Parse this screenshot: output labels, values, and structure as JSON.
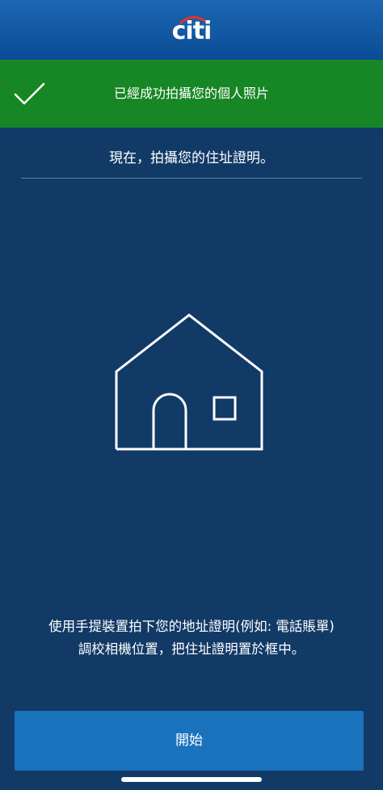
{
  "header": {
    "logo_text": "citi",
    "logo_icon": "citi-arc-logo",
    "background_color": "#0a4c95"
  },
  "success_banner": {
    "icon": "checkmark-icon",
    "message": "已經成功拍攝您的個人照片",
    "background_color": "#178624"
  },
  "instruction": {
    "title": "現在，拍攝您的住址證明。"
  },
  "illustration": {
    "icon": "house-icon"
  },
  "description": {
    "line1": "使用手提裝置拍下您的地址證明(例如: 電話賬單)",
    "line2": "調校相機位置，把住址證明置於框中。"
  },
  "actions": {
    "start_label": "開始",
    "button_color": "#1a72bd"
  },
  "colors": {
    "page_background": "#123a66"
  }
}
